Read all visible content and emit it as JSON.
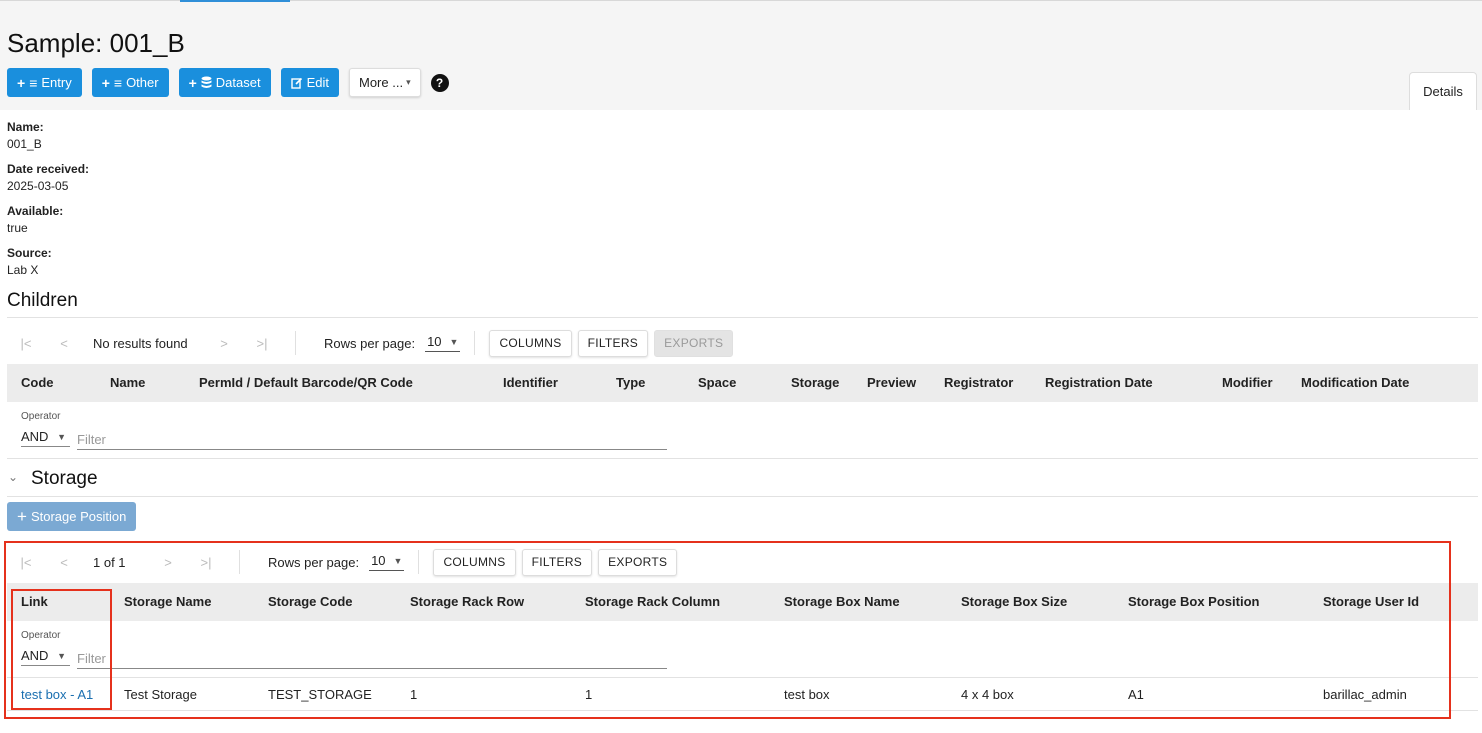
{
  "page": {
    "title": "Sample: 001_B"
  },
  "toolbar": {
    "entry_label": "Entry",
    "other_label": "Other",
    "dataset_label": "Dataset",
    "edit_label": "Edit",
    "more_label": "More ...",
    "help_glyph": "?"
  },
  "tabs": {
    "details": "Details"
  },
  "fields": [
    {
      "label": "Name:",
      "value": "001_B"
    },
    {
      "label": "Date received:",
      "value": "2025-03-05"
    },
    {
      "label": "Available:",
      "value": "true"
    },
    {
      "label": "Source:",
      "value": "Lab X"
    }
  ],
  "children": {
    "title": "Children",
    "pager": {
      "status": "No results found",
      "rows_label": "Rows per page:",
      "rows_value": "10",
      "columns_btn": "COLUMNS",
      "filters_btn": "FILTERS",
      "exports_btn": "EXPORTS"
    },
    "columns": [
      "Code",
      "Name",
      "PermId / Default Barcode/QR Code",
      "Identifier",
      "Type",
      "Space",
      "Storage",
      "Preview",
      "Registrator",
      "Registration Date",
      "Modifier",
      "Modification Date"
    ],
    "filter": {
      "operator_label": "Operator",
      "operator_value": "AND",
      "placeholder": "Filter"
    }
  },
  "storage": {
    "title": "Storage",
    "add_button": "Storage Position",
    "pager": {
      "status": "1 of 1",
      "rows_label": "Rows per page:",
      "rows_value": "10",
      "columns_btn": "COLUMNS",
      "filters_btn": "FILTERS",
      "exports_btn": "EXPORTS"
    },
    "columns": [
      "Link",
      "Storage Name",
      "Storage Code",
      "Storage Rack Row",
      "Storage Rack Column",
      "Storage Box Name",
      "Storage Box Size",
      "Storage Box Position",
      "Storage User Id"
    ],
    "filter": {
      "operator_label": "Operator",
      "operator_value": "AND",
      "placeholder": "Filter"
    },
    "rows": [
      [
        "test box - A1",
        "Test Storage",
        "TEST_STORAGE",
        "1",
        "1",
        "test box",
        "4 x 4 box",
        "A1",
        "barillac_admin"
      ]
    ]
  },
  "colors": {
    "primary": "#1a8fdd",
    "link": "#1a6fb0",
    "highlight": "#e5311c"
  },
  "icons": [
    "plus-icon",
    "list-icon",
    "database-icon",
    "edit-icon",
    "caret-down-icon",
    "help-icon",
    "first-page-icon",
    "prev-page-icon",
    "next-page-icon",
    "last-page-icon",
    "chevron-down-icon"
  ]
}
